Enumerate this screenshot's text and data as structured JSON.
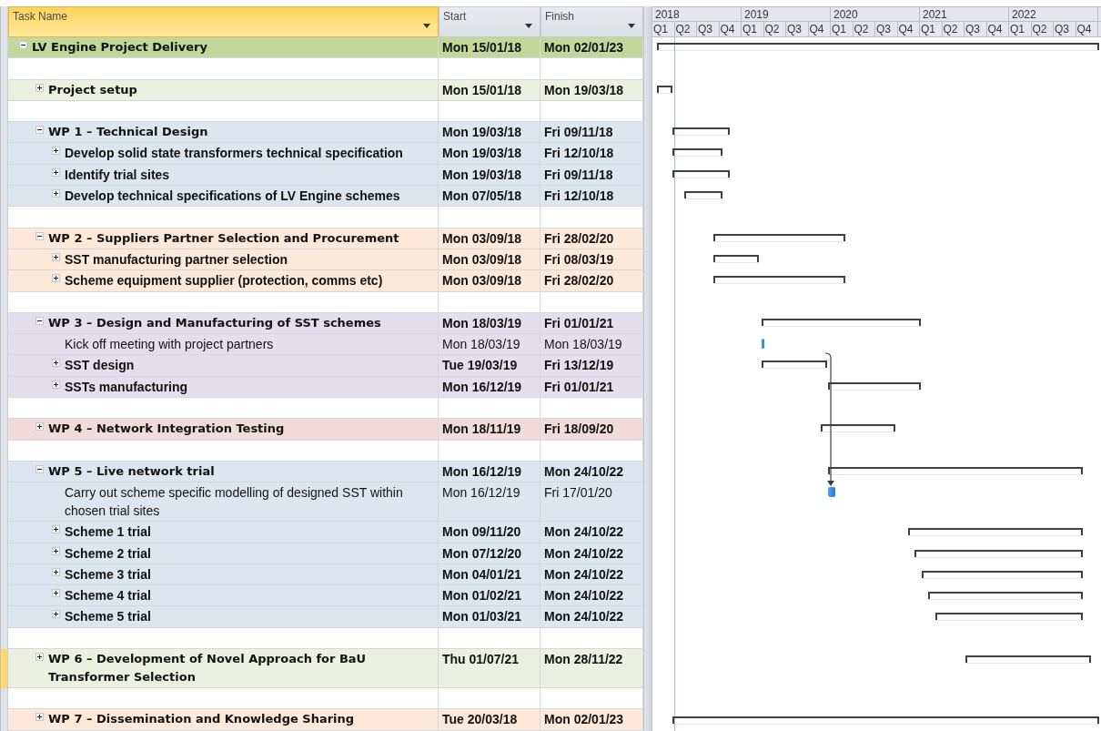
{
  "columns": [
    {
      "label": "Task Name",
      "selected": true
    },
    {
      "label": "Start",
      "selected": false
    },
    {
      "label": "Finish",
      "selected": false
    }
  ],
  "timeline": {
    "years": [
      {
        "label": "2018",
        "quarters": [
          "Q1",
          "Q2",
          "Q3",
          "Q4"
        ]
      },
      {
        "label": "2019",
        "quarters": [
          "Q1",
          "Q2",
          "Q3",
          "Q4"
        ]
      },
      {
        "label": "2020",
        "quarters": [
          "Q1",
          "Q2",
          "Q3",
          "Q4"
        ]
      },
      {
        "label": "2021",
        "quarters": [
          "Q1",
          "Q2",
          "Q3",
          "Q4"
        ]
      },
      {
        "label": "2022",
        "quarters": [
          "Q1",
          "Q2",
          "Q3",
          "Q4"
        ]
      }
    ]
  },
  "tasks": [
    {
      "kind": "summary",
      "name": "LV Engine Project Delivery",
      "start": "Mon 15/01/18",
      "finish": "Mon 02/01/23",
      "expanded": true,
      "selected": false,
      "color": "#c4d79b",
      "children": [
        {
          "kind": "blank",
          "selected": false
        },
        {
          "kind": "summary",
          "name": "Project setup",
          "start": "Mon 15/01/18",
          "finish": "Mon 19/03/18",
          "expanded": false,
          "selected": false,
          "color": "#ebf1de"
        },
        {
          "kind": "blank",
          "selected": false
        },
        {
          "kind": "summary",
          "name": "WP 1 – Technical Design",
          "start": "Mon 19/03/18",
          "finish": "Fri 09/11/18",
          "expanded": true,
          "selected": false,
          "color": "#dce6f1",
          "children": [
            {
              "kind": "summary",
              "name": "Develop solid state transformers technical specification",
              "start": "Mon 19/03/18",
              "finish": "Fri 12/10/18",
              "expanded": false,
              "selected": false
            },
            {
              "kind": "summary",
              "name": "Identify trial sites",
              "start": "Mon 19/03/18",
              "finish": "Fri 09/11/18",
              "expanded": false,
              "selected": false
            },
            {
              "kind": "summary",
              "name": "Develop technical specifications of LV Engine schemes",
              "start": "Mon 07/05/18",
              "finish": "Fri 12/10/18",
              "expanded": false,
              "selected": false
            }
          ]
        },
        {
          "kind": "blank",
          "selected": false
        },
        {
          "kind": "summary",
          "name": "WP 2 – Suppliers Partner Selection and Procurement",
          "start": "Mon 03/09/18",
          "finish": "Fri 28/02/20",
          "expanded": true,
          "selected": false,
          "color": "#fde9d9",
          "children": [
            {
              "kind": "summary",
              "name": "SST manufacturing partner selection",
              "start": "Mon 03/09/18",
              "finish": "Fri 08/03/19",
              "expanded": false,
              "selected": false
            },
            {
              "kind": "summary",
              "name": "Scheme equipment supplier (protection, comms etc)",
              "start": "Mon 03/09/18",
              "finish": "Fri 28/02/20",
              "expanded": false,
              "selected": false
            }
          ]
        },
        {
          "kind": "blank",
          "selected": false
        },
        {
          "kind": "summary",
          "name": "WP 3 – Design and Manufacturing of SST schemes",
          "start": "Mon 18/03/19",
          "finish": "Fri 01/01/21",
          "expanded": true,
          "selected": false,
          "color": "#e4dfec",
          "children": [
            {
              "kind": "task",
              "name": "Kick off meeting with project partners",
              "start": "Mon 18/03/19",
              "finish": "Mon 18/03/19",
              "selected": false
            },
            {
              "kind": "summary",
              "name": "SST design",
              "start": "Tue 19/03/19",
              "finish": "Fri 13/12/19",
              "expanded": false,
              "selected": false
            },
            {
              "kind": "summary",
              "name": "SSTs manufacturing",
              "start": "Mon 16/12/19",
              "finish": "Fri 01/01/21",
              "expanded": false,
              "selected": false
            }
          ]
        },
        {
          "kind": "blank",
          "selected": false
        },
        {
          "kind": "summary",
          "name": "WP 4 – Network Integration Testing",
          "start": "Mon 18/11/19",
          "finish": "Fri 18/09/20",
          "expanded": false,
          "selected": false,
          "color": "#f2dcdb"
        },
        {
          "kind": "blank",
          "selected": false
        },
        {
          "kind": "summary",
          "name": "WP 5 – Live network trial",
          "start": "Mon 16/12/19",
          "finish": "Mon 24/10/22",
          "expanded": true,
          "selected": false,
          "color": "#dce6f1",
          "children": [
            {
              "kind": "task",
              "name": "Carry out scheme specific modelling of designed SST within chosen trial sites",
              "start": "Mon 16/12/19",
              "finish": "Fri 17/01/20",
              "selected": false,
              "has_predecessor": true
            },
            {
              "kind": "summary",
              "name": "Scheme 1 trial",
              "start": "Mon 09/11/20",
              "finish": "Mon 24/10/22",
              "expanded": false,
              "selected": false
            },
            {
              "kind": "summary",
              "name": "Scheme 2 trial",
              "start": "Mon 07/12/20",
              "finish": "Mon 24/10/22",
              "expanded": false,
              "selected": false
            },
            {
              "kind": "summary",
              "name": "Scheme 3 trial",
              "start": "Mon 04/01/21",
              "finish": "Mon 24/10/22",
              "expanded": false,
              "selected": false
            },
            {
              "kind": "summary",
              "name": "Scheme 4 trial",
              "start": "Mon 01/02/21",
              "finish": "Mon 24/10/22",
              "expanded": false,
              "selected": false
            },
            {
              "kind": "summary",
              "name": "Scheme 5 trial",
              "start": "Mon 01/03/21",
              "finish": "Mon 24/10/22",
              "expanded": false,
              "selected": false
            }
          ]
        },
        {
          "kind": "blank",
          "selected": false
        },
        {
          "kind": "summary",
          "name": "WP 6 – Development of Novel Approach for BaU Transformer Selection",
          "start": "Thu 01/07/21",
          "finish": "Mon 28/11/22",
          "expanded": false,
          "selected": true,
          "color": "#ebf1de"
        },
        {
          "kind": "blank",
          "selected": false
        },
        {
          "kind": "summary",
          "name": "WP 7 – Dissemination and Knowledge Sharing",
          "start": "Tue 20/03/18",
          "finish": "Mon 02/01/23",
          "expanded": false,
          "selected": false,
          "color": "#fde9d9"
        }
      ]
    }
  ]
}
